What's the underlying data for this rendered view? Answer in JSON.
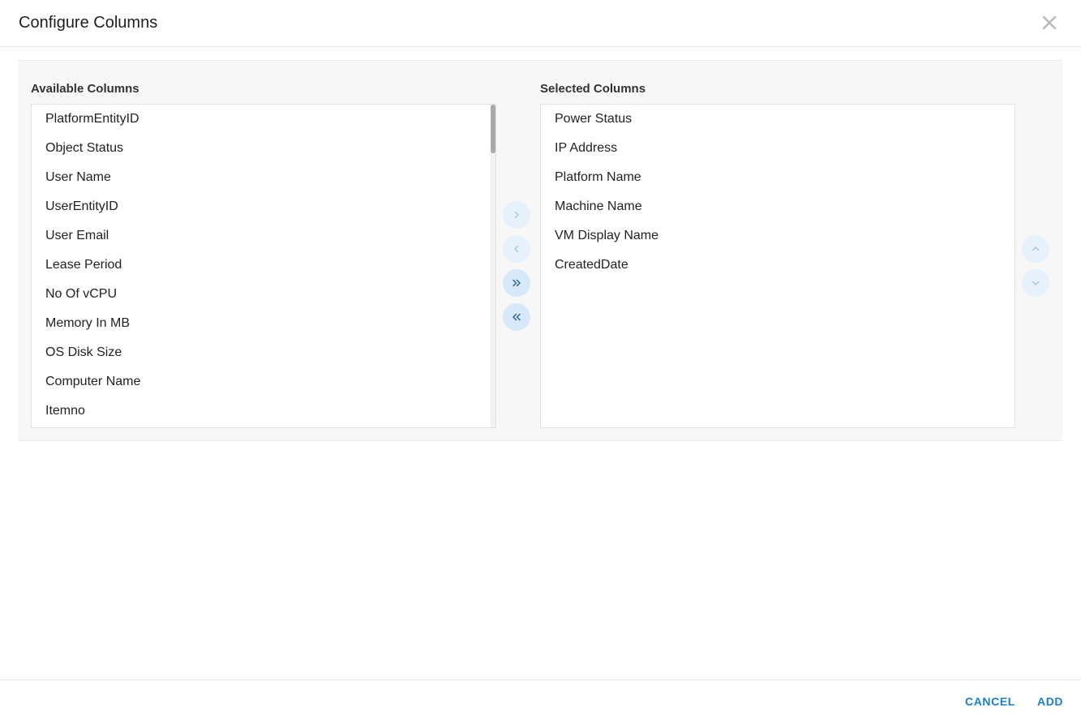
{
  "dialog": {
    "title": "Configure Columns",
    "close_icon": "close-icon"
  },
  "available": {
    "label": "Available Columns",
    "items": [
      "PlatformEntityID",
      "Object Status",
      "User Name",
      "UserEntityID",
      "User Email",
      "Lease Period",
      "No Of vCPU",
      "Memory In MB",
      "OS Disk Size",
      "Computer Name",
      "Itemno"
    ]
  },
  "selected": {
    "label": "Selected Columns",
    "items": [
      "Power Status",
      "IP Address",
      "Platform Name",
      "Machine Name",
      "VM Display Name",
      "CreatedDate"
    ]
  },
  "transfer_buttons": {
    "move_right_icon": "chevron-right-icon",
    "move_left_icon": "chevron-left-icon",
    "move_all_right_icon": "double-chevron-right-icon",
    "move_all_left_icon": "double-chevron-left-icon"
  },
  "order_buttons": {
    "move_up_icon": "chevron-up-icon",
    "move_down_icon": "chevron-down-icon"
  },
  "footer": {
    "cancel_label": "CANCEL",
    "add_label": "ADD"
  },
  "colors": {
    "accent": "#1a7fc8",
    "button_active_bg": "#d6e8f9",
    "button_dim_bg": "#e7f1fb",
    "panel_bg": "#f7f7f7"
  }
}
